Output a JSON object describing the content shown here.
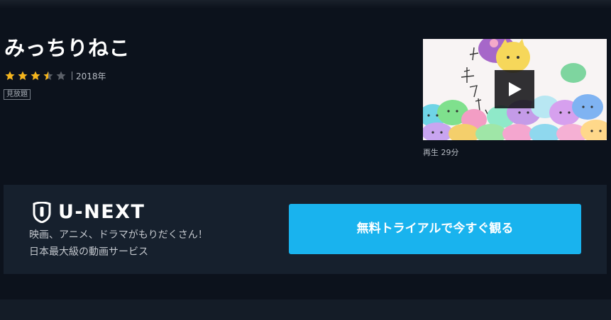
{
  "title": "みっちりねこ",
  "rating": {
    "value": 3.5,
    "max": 5,
    "filled_color": "#f5b51c",
    "empty_color": "#5b6068",
    "icon": "star-icon"
  },
  "year": "2018年",
  "badge": "見放題",
  "video": {
    "thumbnail_icon": "video-thumbnail",
    "play_icon": "play-icon",
    "duration_label": "再生 29分"
  },
  "promo": {
    "logo_text": "U-NEXT",
    "logo_icon": "shield-icon",
    "tagline_line1": "映画、アニメ、ドラマがもりだくさん！",
    "tagline_line2": "日本最大級の動画サービス",
    "cta_label": "無料トライアルで今すぐ観る",
    "cta_color": "#19b3ee"
  }
}
